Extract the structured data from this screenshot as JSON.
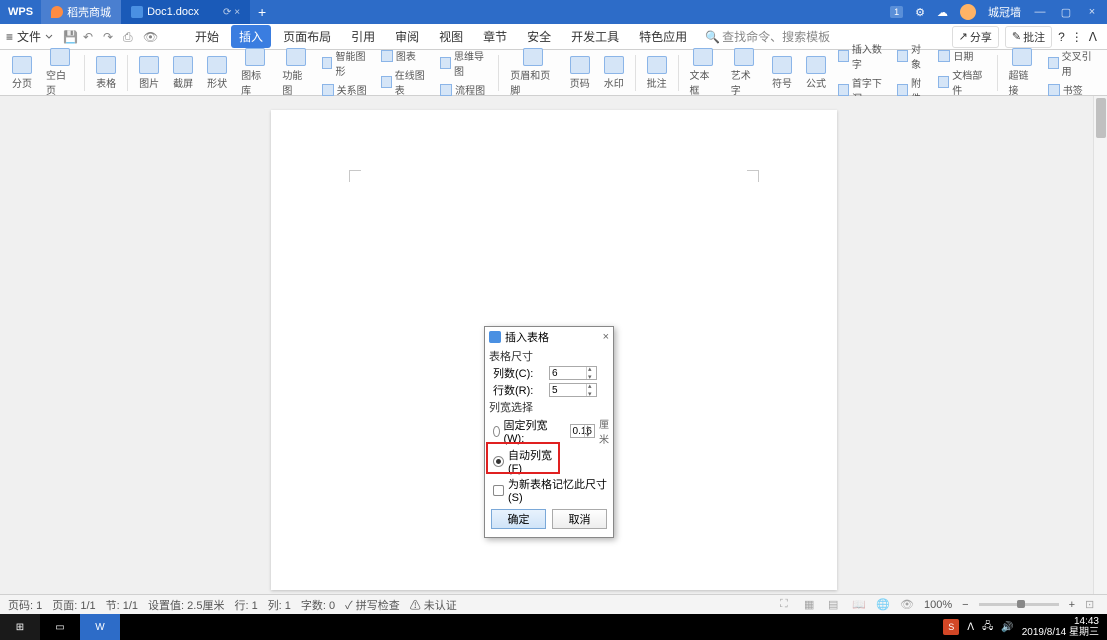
{
  "titlebar": {
    "app": "WPS",
    "tab_store": "稻壳商城",
    "tab_doc": "Doc1.docx",
    "newtab": "+",
    "badge": "1",
    "username": "城冠墙"
  },
  "menu": {
    "file": "文件",
    "tabs": [
      "开始",
      "插入",
      "页面布局",
      "引用",
      "审阅",
      "视图",
      "章节",
      "安全",
      "开发工具",
      "特色应用"
    ],
    "active_index": 1,
    "search_placeholder": "查找命令、搜索模板",
    "share": "分享",
    "annot": "批注"
  },
  "ribbon": {
    "items_big": [
      "分页",
      "空白页",
      "表格",
      "图片",
      "截屏",
      "形状",
      "图标库",
      "功能图"
    ],
    "items_small_col1": [
      "智能图形",
      "关系图"
    ],
    "items_small_col2": [
      "图表",
      "在线图表"
    ],
    "items_small_col3": [
      "思维导图",
      "流程图"
    ],
    "items_big2": [
      "页眉和页脚",
      "页码",
      "水印",
      "批注",
      "文本框",
      "艺术字",
      "符号",
      "公式"
    ],
    "items_small_col4": [
      "插入数字",
      "首字下沉"
    ],
    "items_small_col5": [
      "对象",
      "附件"
    ],
    "items_small_col6": [
      "日期",
      "文档部件"
    ],
    "items_big3": [
      "超链接"
    ],
    "items_small_col7": [
      "交叉引用",
      "书签"
    ]
  },
  "dialog": {
    "title": "插入表格",
    "section1": "表格尺寸",
    "cols_label": "列数(C):",
    "cols_value": "6",
    "rows_label": "行数(R):",
    "rows_value": "5",
    "section2": "列宽选择",
    "fixed_label": "固定列宽(W):",
    "fixed_value": "0.16",
    "fixed_unit": "厘米",
    "auto_label": "自动列宽(F)",
    "remember_label": "为新表格记忆此尺寸(S)",
    "ok": "确定",
    "cancel": "取消"
  },
  "status": {
    "page": "页码: 1",
    "pages": "页面: 1/1",
    "section": "节: 1/1",
    "setvalue": "设置值: 2.5厘米",
    "line": "行: 1",
    "col": "列: 1",
    "words": "字数: 0",
    "spell": "拼写检查",
    "doccheck": "未认证",
    "zoom": "100%"
  },
  "taskbar": {
    "time": "14:43",
    "date": "2019/8/14 星期三",
    "ime": "S"
  }
}
